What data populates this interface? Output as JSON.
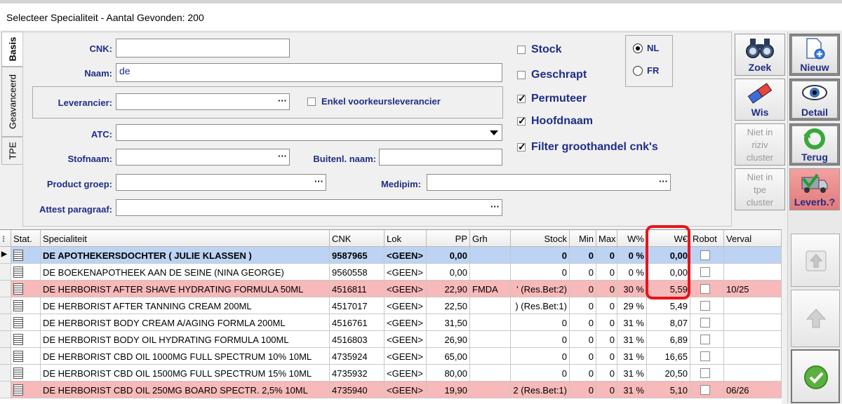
{
  "window": {
    "title": "Selecteer Specialiteit - Aantal Gevonden: 200"
  },
  "tabs": [
    "Basis",
    "Geavanceerd",
    "TPE"
  ],
  "form": {
    "cnk_label": "CNK:",
    "cnk_value": "",
    "naam_label": "Naam:",
    "naam_value": "de",
    "leverancier_label": "Leverancier:",
    "leverancier_value": "",
    "enkel_voorkeur_label": "Enkel voorkeursleverancier",
    "atc_label": "ATC:",
    "atc_value": "",
    "stofnaam_label": "Stofnaam:",
    "stofnaam_value": "",
    "buitenl_label": "Buitenl. naam:",
    "buitenl_value": "",
    "productgroep_label": "Product groep:",
    "productgroep_value": "",
    "medipim_label": "Medipim:",
    "medipim_value": "",
    "attest_label": "Attest paragraaf:",
    "attest_value": "",
    "dots": "···"
  },
  "checks": {
    "stock": {
      "label": "Stock",
      "checked": false
    },
    "geschrapt": {
      "label": "Geschrapt",
      "checked": false
    },
    "permuteer": {
      "label": "Permuteer",
      "checked": true
    },
    "hoofdnaam": {
      "label": "Hoofdnaam",
      "checked": true
    },
    "filter": {
      "label": "Filter groothandel cnk's",
      "checked": true
    }
  },
  "language": {
    "nl": "NL",
    "fr": "FR",
    "selected": "NL"
  },
  "buttons": {
    "zoek": "Zoek",
    "wis": "Wis",
    "niet_riziv": [
      "Niet in",
      "riziv",
      "cluster"
    ],
    "niet_tpe": [
      "Niet in",
      "tpe",
      "cluster"
    ],
    "nieuw": "Nieuw",
    "detail": "Detail",
    "terug": "Terug",
    "leverb": "Leverb.?"
  },
  "table": {
    "columns": [
      "Stat.",
      "Specialiteit",
      "CNK",
      "Lok",
      "PP",
      "Grh",
      "Stock",
      "Min",
      "Max",
      "W%",
      "W€",
      "Robot",
      "Verval"
    ],
    "rows": [
      {
        "spec": "DE APOTHEKERSDOCHTER ( JULIE KLASSEN )",
        "cnk": "9587965",
        "lok": "<GEEN>",
        "pp": "0,00",
        "grh": "",
        "stock": "0",
        "min": "0",
        "max": "0",
        "wp": "0 %",
        "we": "0,00",
        "verval": "",
        "style": "sel"
      },
      {
        "spec": "DE BOEKENAPOTHEEK AAN DE SEINE (NINA GEORGE)",
        "cnk": "9560558",
        "lok": "<GEEN>",
        "pp": "0,00",
        "grh": "",
        "stock": "0",
        "min": "0",
        "max": "0",
        "wp": "0 %",
        "we": "0,00",
        "verval": "",
        "style": ""
      },
      {
        "spec": "DE HERBORIST AFTER SHAVE HYDRATING FORMULA    50ML",
        "cnk": "4516811",
        "lok": "<GEEN>",
        "pp": "22,90",
        "grh": "FMDA",
        "stock": "' (Res.Bet:2)",
        "min": "0",
        "max": "0",
        "wp": "30 %",
        "we": "5,59",
        "verval": "10/25",
        "style": "pink"
      },
      {
        "spec": "DE HERBORIST AFTER TANNING CREAM            200ML",
        "cnk": "4517017",
        "lok": "<GEEN>",
        "pp": "22,50",
        "grh": "",
        "stock": ") (Res.Bet:1)",
        "min": "0",
        "max": "0",
        "wp": "29 %",
        "we": "5,49",
        "verval": "",
        "style": ""
      },
      {
        "spec": "DE HERBORIST BODY CREAM A/AGING FORMLA      200ML",
        "cnk": "4516761",
        "lok": "<GEEN>",
        "pp": "31,50",
        "grh": "",
        "stock": "0",
        "min": "0",
        "max": "0",
        "wp": "31 %",
        "we": "8,07",
        "verval": "",
        "style": ""
      },
      {
        "spec": "DE HERBORIST BODY OIL HYDRATING FORMULA     100ML",
        "cnk": "4516803",
        "lok": "<GEEN>",
        "pp": "26,90",
        "grh": "",
        "stock": "0",
        "min": "0",
        "max": "0",
        "wp": "31 %",
        "we": "6,89",
        "verval": "",
        "style": ""
      },
      {
        "spec": "DE HERBORIST CBD OIL 1000MG FULL SPECTRUM 10% 10ML",
        "cnk": "4735924",
        "lok": "<GEEN>",
        "pp": "65,00",
        "grh": "",
        "stock": "0",
        "min": "0",
        "max": "0",
        "wp": "31 %",
        "we": "16,65",
        "verval": "",
        "style": ""
      },
      {
        "spec": "DE HERBORIST CBD OIL 1500MG FULL SPECTRUM 15% 10ML",
        "cnk": "4735932",
        "lok": "<GEEN>",
        "pp": "80,00",
        "grh": "",
        "stock": "0",
        "min": "0",
        "max": "0",
        "wp": "31 %",
        "we": "20,50",
        "verval": "",
        "style": ""
      },
      {
        "spec": "DE HERBORIST CBD OIL 250MG BOARD SPECTR. 2,5% 10ML",
        "cnk": "4735940",
        "lok": "<GEEN>",
        "pp": "19,90",
        "grh": "",
        "stock": "2 (Res.Bet:1)",
        "min": "0",
        "max": "0",
        "wp": "31 %",
        "we": "5,10",
        "verval": "06/26",
        "style": "pink"
      }
    ]
  }
}
